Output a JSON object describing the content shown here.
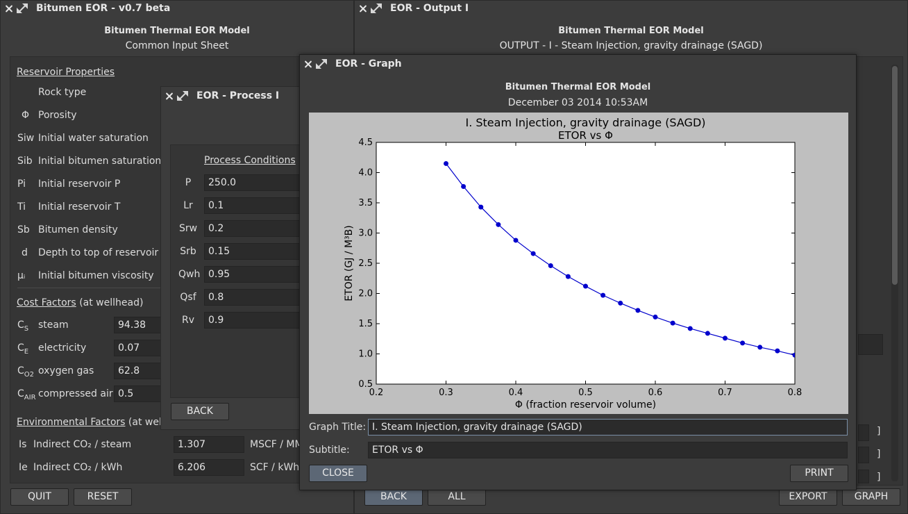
{
  "input_window": {
    "title": "Bitumen EOR - v0.7 beta",
    "heading": "Bitumen Thermal EOR Model",
    "subheading": "Common Input Sheet",
    "reservoir_section": "Reservoir Properties",
    "reservoir_rows": [
      {
        "sym": "",
        "label": "Rock type"
      },
      {
        "sym": "Φ",
        "label": "Porosity"
      },
      {
        "sym": "Siw",
        "label": "Initial water saturation"
      },
      {
        "sym": "Sib",
        "label": "Initial bitumen saturation"
      },
      {
        "sym": "Pi",
        "label": "Initial reservoir P"
      },
      {
        "sym": "Ti",
        "label": "Initial reservoir T"
      },
      {
        "sym": "Sb",
        "label": "Bitumen density"
      },
      {
        "sym": "d",
        "label": "Depth to top of reservoir"
      },
      {
        "sym": "μᵢ",
        "label": "Initial bitumen viscosity"
      }
    ],
    "cost_section": "Cost Factors",
    "cost_section_suffix": "(at wellhead)",
    "cost_rows": [
      {
        "sym": "C",
        "sub": "S",
        "label": "steam",
        "value": "94.38"
      },
      {
        "sym": "C",
        "sub": "E",
        "label": "electricity",
        "value": "0.07"
      },
      {
        "sym": "C",
        "sub": "O2",
        "label": "oxygen gas",
        "value": "62.8"
      },
      {
        "sym": "C",
        "sub": "AIR",
        "label": "compressed air",
        "value": "0.5"
      }
    ],
    "env_section": "Environmental Factors",
    "env_section_suffix": "(at well h",
    "env_rows": [
      {
        "sym": "Is",
        "label": "Indirect CO₂ / steam",
        "value": "1.307",
        "unit": "MSCF / MM"
      },
      {
        "sym": "Ie",
        "label": "Indirect CO₂ / kWh",
        "value": "6.206",
        "unit": "SCF / kWh"
      }
    ],
    "quit_label": "QUIT",
    "reset_label": "RESET"
  },
  "output_window": {
    "title": "EOR - Output I",
    "heading": "Bitumen Thermal EOR Model",
    "subheading": "OUTPUT - I - Steam Injection, gravity drainage (SAGD)",
    "bracket": "]",
    "back_label": "BACK",
    "all_label": "ALL",
    "export_label": "EXPORT",
    "graph_label": "GRAPH"
  },
  "process_window": {
    "title": "EOR - Process I",
    "section": "Process Conditions",
    "rows": [
      {
        "label": "P",
        "value": "250.0"
      },
      {
        "label": "Lr",
        "value": "0.1"
      },
      {
        "label": "Srw",
        "value": "0.2"
      },
      {
        "label": "Srb",
        "value": "0.15"
      },
      {
        "label": "Qwh",
        "value": "0.95"
      },
      {
        "label": "Qsf",
        "value": "0.8"
      },
      {
        "label": "Rv",
        "value": "0.9"
      }
    ],
    "back_label": "BACK"
  },
  "graph_window": {
    "title": "EOR - Graph",
    "heading": "Bitumen Thermal EOR Model",
    "date": "December 03 2014 10:53AM",
    "graph_title_label": "Graph Title:",
    "graph_title_value": "I. Steam Injection, gravity drainage (SAGD)",
    "subtitle_label": "Subtitle:",
    "subtitle_value": "ETOR vs Φ",
    "close_label": "CLOSE",
    "print_label": "PRINT"
  },
  "colors": {
    "series": "#0000cc",
    "plot_bg": "#bfbfbf"
  },
  "chart_data": {
    "type": "line",
    "title": "I. Steam Injection, gravity drainage (SAGD)",
    "subtitle": "ETOR vs Φ",
    "xlabel": "Φ (fraction reservoir volume)",
    "ylabel": "ETOR (GJ / M³B)",
    "xlim": [
      0.2,
      0.8
    ],
    "ylim": [
      0.5,
      4.5
    ],
    "xticks": [
      "0.2",
      "0.3",
      "0.4",
      "0.5",
      "0.6",
      "0.7",
      "0.8"
    ],
    "yticks": [
      "0.5",
      "1.0",
      "1.5",
      "2.0",
      "2.5",
      "3.0",
      "3.5",
      "4.0",
      "4.5"
    ],
    "grid": false,
    "x": [
      0.3,
      0.325,
      0.35,
      0.375,
      0.4,
      0.425,
      0.45,
      0.475,
      0.5,
      0.525,
      0.55,
      0.575,
      0.6,
      0.625,
      0.65,
      0.675,
      0.7,
      0.725,
      0.75,
      0.775,
      0.8
    ],
    "series": [
      {
        "values": [
          4.15,
          3.77,
          3.43,
          3.14,
          2.88,
          2.66,
          2.46,
          2.28,
          2.12,
          1.97,
          1.84,
          1.72,
          1.61,
          1.51,
          1.42,
          1.34,
          1.26,
          1.18,
          1.11,
          1.05,
          0.98
        ]
      }
    ]
  }
}
